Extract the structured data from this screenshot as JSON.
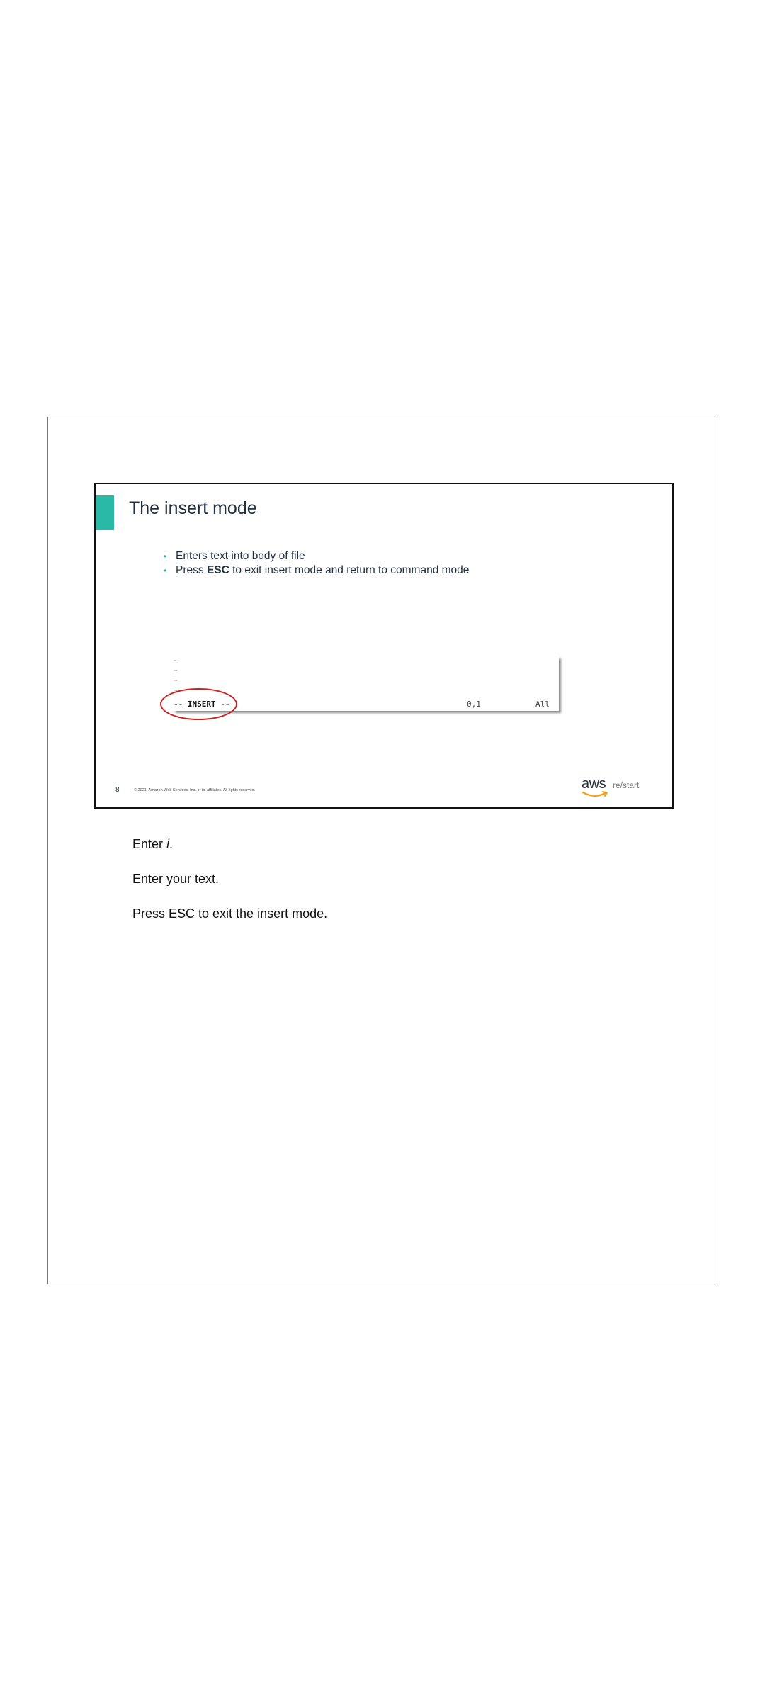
{
  "slide": {
    "title": "The insert mode",
    "bullets": [
      "Enters text into body of file",
      {
        "before": "Press ",
        "bold": "ESC",
        "after": " to exit insert mode and return to command mode"
      }
    ],
    "terminal": {
      "tildes": [
        "~",
        "~",
        "~",
        "~"
      ],
      "mode_indicator": "-- INSERT --",
      "cursor_position": "0,1",
      "scroll_position": "All"
    },
    "slide_number": "8",
    "copyright": "© 2021, Amazon Web Services, Inc. or its affiliates. All rights reserved.",
    "logo": {
      "brand": "aws",
      "product": "re/start"
    }
  },
  "notes": {
    "line1_prefix": "Enter ",
    "line1_italic": "i",
    "line1_suffix": ".",
    "line2": "Enter your text.",
    "line3": "Press ESC to exit the insert mode."
  },
  "colors": {
    "accent": "#2bb9a7",
    "highlight": "#cc1f1f",
    "text": "#232f3e",
    "logo_smile": "#f7a01c"
  }
}
